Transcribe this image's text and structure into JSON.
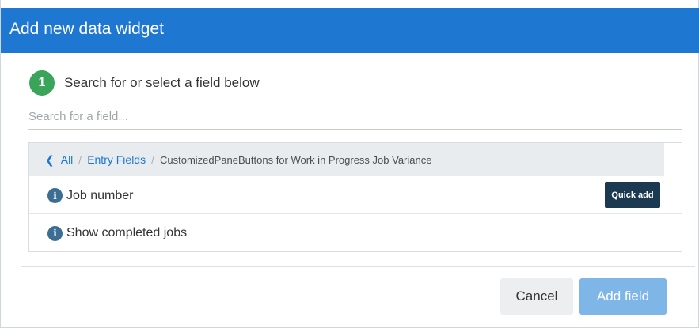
{
  "dialog": {
    "title": "Add new data widget"
  },
  "step": {
    "number": "1",
    "text": "Search for or select a field below"
  },
  "search": {
    "placeholder": "Search for a field...",
    "value": ""
  },
  "breadcrumb": {
    "back_icon": "chevron-left-icon",
    "items": [
      "All",
      "Entry Fields"
    ],
    "separator": "/",
    "current": "CustomizedPaneButtons for Work in Progress Job Variance"
  },
  "fields": [
    {
      "label": "Job number",
      "icon": "info-icon",
      "quick_add_label": "Quick add"
    },
    {
      "label": "Show completed jobs",
      "icon": "info-icon"
    }
  ],
  "footer": {
    "cancel_label": "Cancel",
    "add_label": "Add field"
  },
  "colors": {
    "header": "#1e78d2",
    "step_badge": "#3aa45a",
    "link": "#1e78d2",
    "quick_add": "#1b3a52",
    "add_field_disabled": "#7fb6e8"
  }
}
